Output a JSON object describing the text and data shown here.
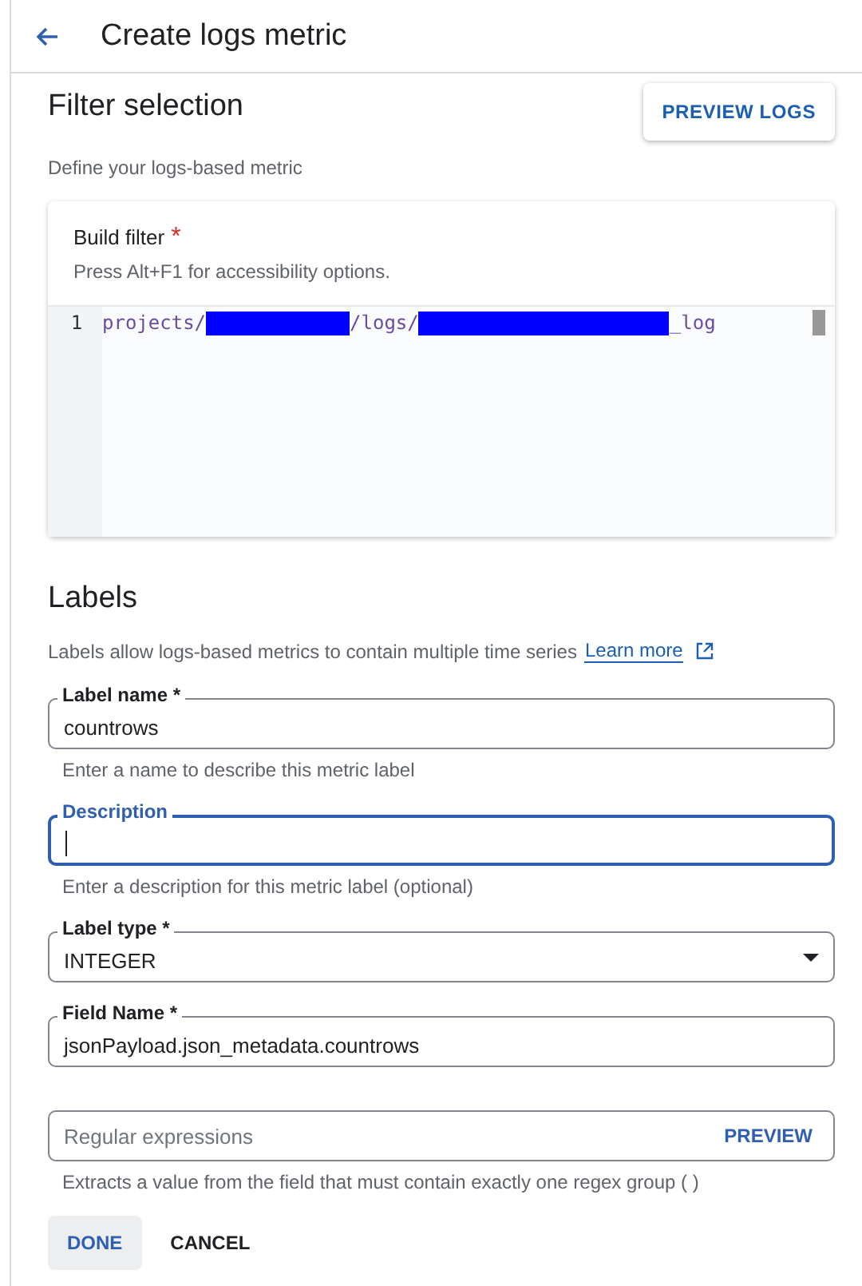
{
  "header": {
    "title": "Create logs metric"
  },
  "filter_section": {
    "title": "Filter selection",
    "preview_button": "PREVIEW LOGS",
    "description": "Define your logs-based metric",
    "editor": {
      "label": "Build filter",
      "required_mark": "*",
      "hint": "Press Alt+F1 for accessibility options.",
      "lines": [
        {
          "number": "1",
          "segments": [
            {
              "kind": "text",
              "text": "projects/"
            },
            {
              "kind": "redacted"
            },
            {
              "kind": "text",
              "text": "/logs/"
            },
            {
              "kind": "redacted"
            },
            {
              "kind": "text",
              "text": "_log"
            }
          ]
        }
      ]
    }
  },
  "labels_section": {
    "title": "Labels",
    "description": "Labels allow logs-based metrics to contain multiple time series",
    "link": "Learn more",
    "fields": [
      {
        "kind": "text",
        "label": "Label name *",
        "value": "countrows",
        "focused": false,
        "helper": "Enter a name to describe this metric label"
      },
      {
        "kind": "text",
        "label": "Description",
        "focused": true,
        "helper": "Enter a description for this metric label (optional)"
      },
      {
        "kind": "select",
        "label": "Label type *",
        "value": "INTEGER",
        "focused": false
      },
      {
        "kind": "text",
        "label": "Field Name *",
        "value": "jsonPayload.json_metadata.countrows",
        "focused": false
      },
      {
        "kind": "regex",
        "placeholder": "Regular expressions",
        "action": "PREVIEW",
        "focused": false,
        "helper": "Extracts a value from the field that must contain exactly one regex group ( )"
      }
    ],
    "buttons": [
      {
        "label": "DONE",
        "kind": "primary"
      },
      {
        "label": "CANCEL",
        "kind": "secondary"
      }
    ]
  }
}
